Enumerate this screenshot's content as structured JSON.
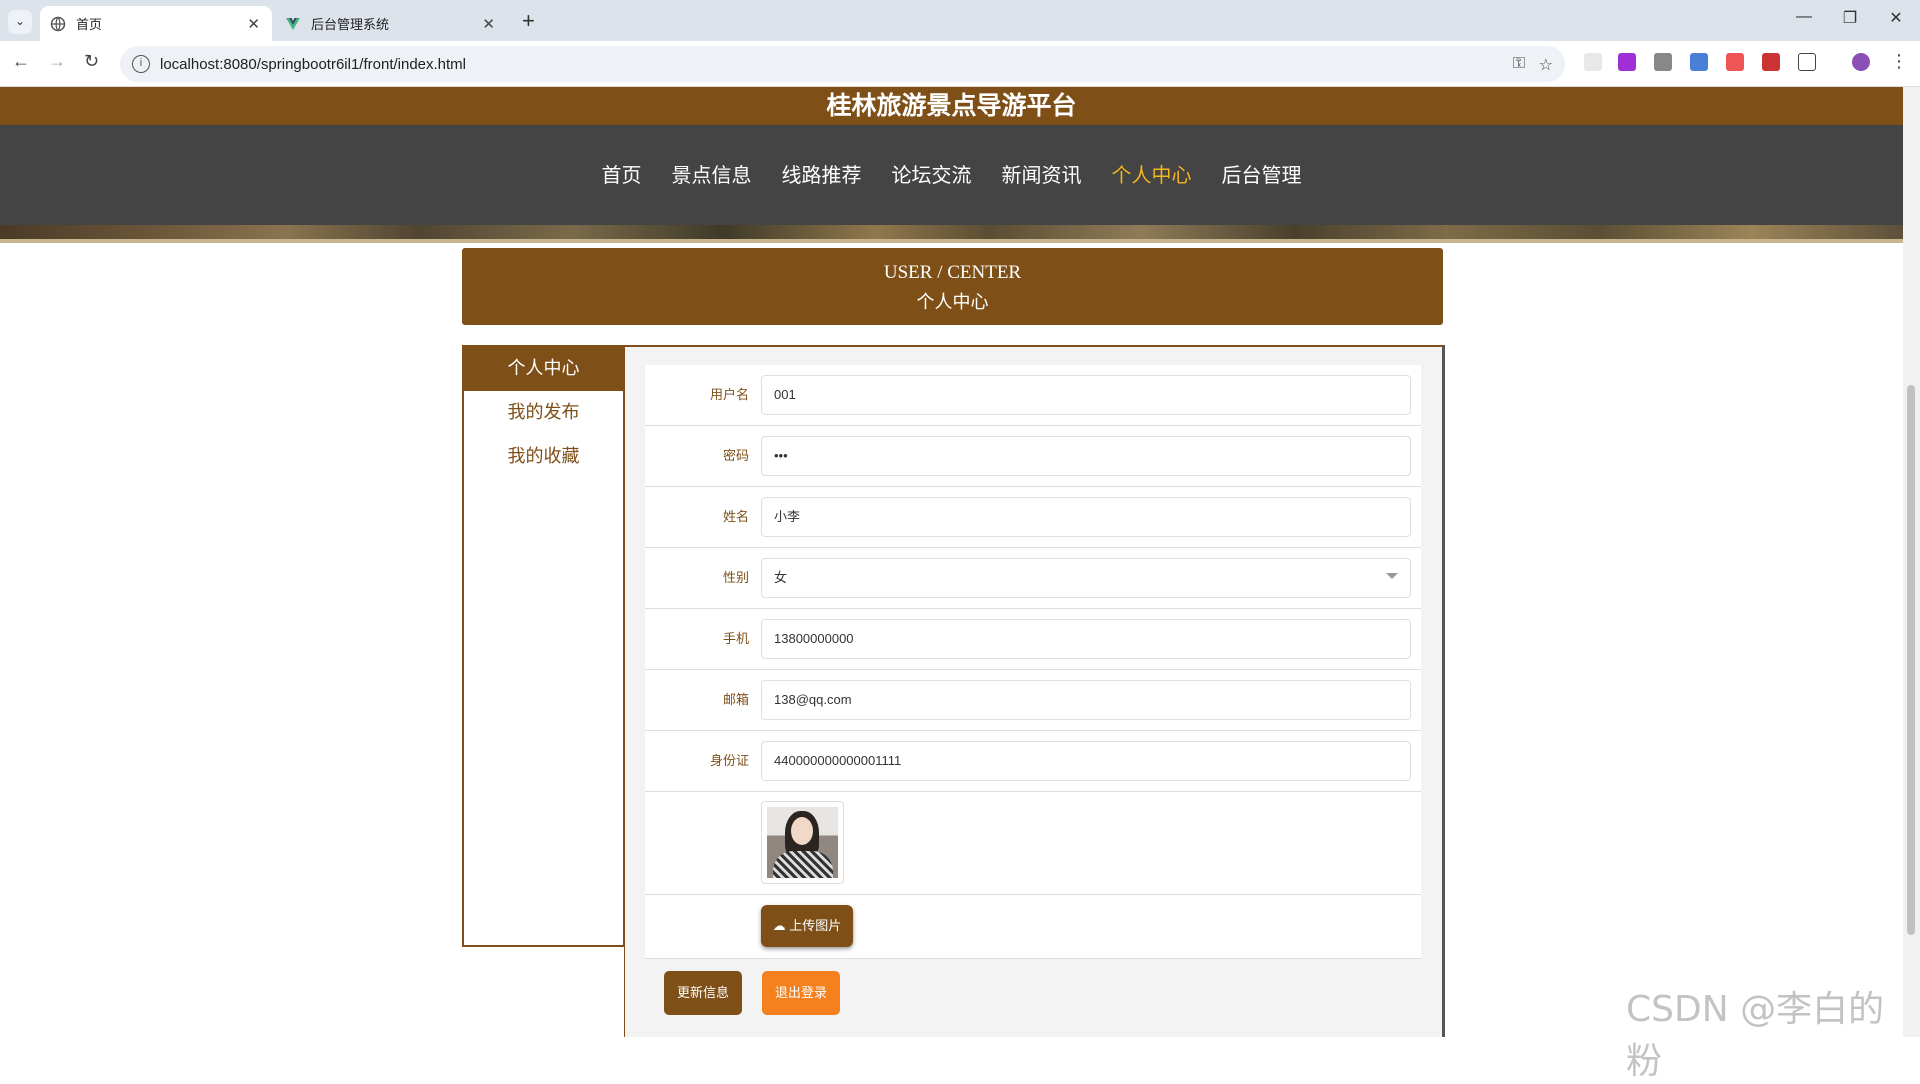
{
  "browser": {
    "tabs": [
      {
        "title": "首页",
        "close": "✕"
      },
      {
        "title": "后台管理系统",
        "close": "✕"
      }
    ],
    "new_tab": "+",
    "url": "localhost:8080/springbootr6il1/front/index.html",
    "window": {
      "minimize": "—",
      "restore": "❐",
      "close": "✕"
    }
  },
  "site": {
    "title": "桂林旅游景点导游平台",
    "nav": [
      "首页",
      "景点信息",
      "线路推荐",
      "论坛交流",
      "新闻资讯",
      "个人中心",
      "后台管理"
    ],
    "active_nav": "个人中心"
  },
  "center_header": {
    "en": "USER / CENTER",
    "cn": "个人中心"
  },
  "sidebar": {
    "items": [
      "个人中心",
      "我的发布",
      "我的收藏"
    ],
    "active": "个人中心"
  },
  "form": {
    "username": {
      "label": "用户名",
      "value": "001"
    },
    "password": {
      "label": "密码",
      "value": "•••"
    },
    "name": {
      "label": "姓名",
      "value": "小李"
    },
    "gender": {
      "label": "性别",
      "value": "女"
    },
    "phone": {
      "label": "手机",
      "value": "13800000000"
    },
    "email": {
      "label": "邮箱",
      "value": "138@qq.com"
    },
    "idcard": {
      "label": "身份证",
      "value": "440000000000001111"
    },
    "upload_label": "上传图片"
  },
  "buttons": {
    "update": "更新信息",
    "logout": "退出登录"
  },
  "watermark": "CSDN @李白的粉",
  "colors": {
    "brand": "#7f4f18",
    "nav_bg": "#444444",
    "nav_active": "#f3b51c",
    "logout": "#f5801e"
  }
}
